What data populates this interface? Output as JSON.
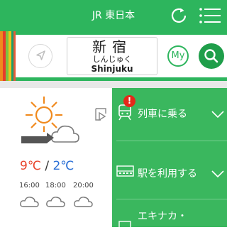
{
  "header": {
    "title": "JR 東日本",
    "refresh_icon": "refresh-icon",
    "menu_icon": "hamburger-menu-icon"
  },
  "station": {
    "name_kanji": "新宿",
    "name_kana": "しんじゅく",
    "name_romaji": "Shinjuku",
    "my_label": "My",
    "accent": "#2db55d"
  },
  "weather": {
    "temp_high": "9℃",
    "separator": "/",
    "temp_low": "2℃",
    "times": [
      "16:00",
      "18:00",
      "20:00"
    ],
    "condition_icon": "sun-behind-cloud-icon"
  },
  "side_menu": {
    "items": [
      {
        "label": "列車に乗る",
        "icon": "train-icon",
        "alert": "!"
      },
      {
        "label": "駅を利用する",
        "icon": "ticket-gate-icon"
      },
      {
        "label": "エキナカ・",
        "icon": "shop-icon"
      }
    ]
  }
}
